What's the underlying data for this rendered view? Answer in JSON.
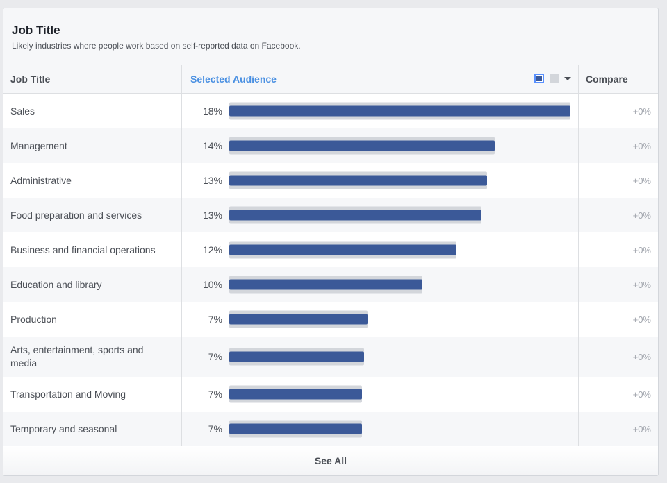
{
  "card": {
    "title": "Job Title",
    "subtitle": "Likely industries where people work based on self-reported data on Facebook."
  },
  "table": {
    "headers": {
      "job_title": "Job Title",
      "selected_audience": "Selected Audience",
      "compare": "Compare"
    },
    "controls": {
      "primary_swatch": "selected-audience-swatch",
      "secondary_swatch": "comparison-swatch",
      "dropdown_icon": "caret-down-icon"
    },
    "rows": [
      {
        "label": "Sales",
        "percent_label": "18%",
        "value": 18.0,
        "compare": "+0%"
      },
      {
        "label": "Management",
        "percent_label": "14%",
        "value": 14.0,
        "compare": "+0%"
      },
      {
        "label": "Administrative",
        "percent_label": "13%",
        "value": 13.6,
        "compare": "+0%"
      },
      {
        "label": "Food preparation and services",
        "percent_label": "13%",
        "value": 13.3,
        "compare": "+0%"
      },
      {
        "label": "Business and financial operations",
        "percent_label": "12%",
        "value": 12.0,
        "compare": "+0%"
      },
      {
        "label": "Education and library",
        "percent_label": "10%",
        "value": 10.2,
        "compare": "+0%"
      },
      {
        "label": "Production",
        "percent_label": "7%",
        "value": 7.3,
        "compare": "+0%"
      },
      {
        "label": "Arts, entertainment, sports and media",
        "percent_label": "7%",
        "value": 7.1,
        "compare": "+0%"
      },
      {
        "label": "Transportation and Moving",
        "percent_label": "7%",
        "value": 7.0,
        "compare": "+0%"
      },
      {
        "label": "Temporary and seasonal",
        "percent_label": "7%",
        "value": 7.0,
        "compare": "+0%"
      }
    ],
    "max_value": 18.0
  },
  "footer": {
    "see_all": "See All"
  },
  "colors": {
    "bar_fill": "#3b5998",
    "bar_track": "#d3d6db",
    "header_accent": "#4a90e2"
  },
  "chart_data": {
    "type": "bar",
    "title": "Job Title",
    "categories": [
      "Sales",
      "Management",
      "Administrative",
      "Food preparation and services",
      "Business and financial operations",
      "Education and library",
      "Production",
      "Arts, entertainment, sports and media",
      "Transportation and Moving",
      "Temporary and seasonal"
    ],
    "series": [
      {
        "name": "Selected Audience",
        "values": [
          18.0,
          14.0,
          13.6,
          13.3,
          12.0,
          10.2,
          7.3,
          7.1,
          7.0,
          7.0
        ]
      }
    ],
    "labels": [
      "18%",
      "14%",
      "13%",
      "13%",
      "12%",
      "10%",
      "7%",
      "7%",
      "7%",
      "7%"
    ],
    "xlabel": "",
    "ylabel": "",
    "orientation": "horizontal",
    "xlim": [
      0,
      18
    ]
  }
}
